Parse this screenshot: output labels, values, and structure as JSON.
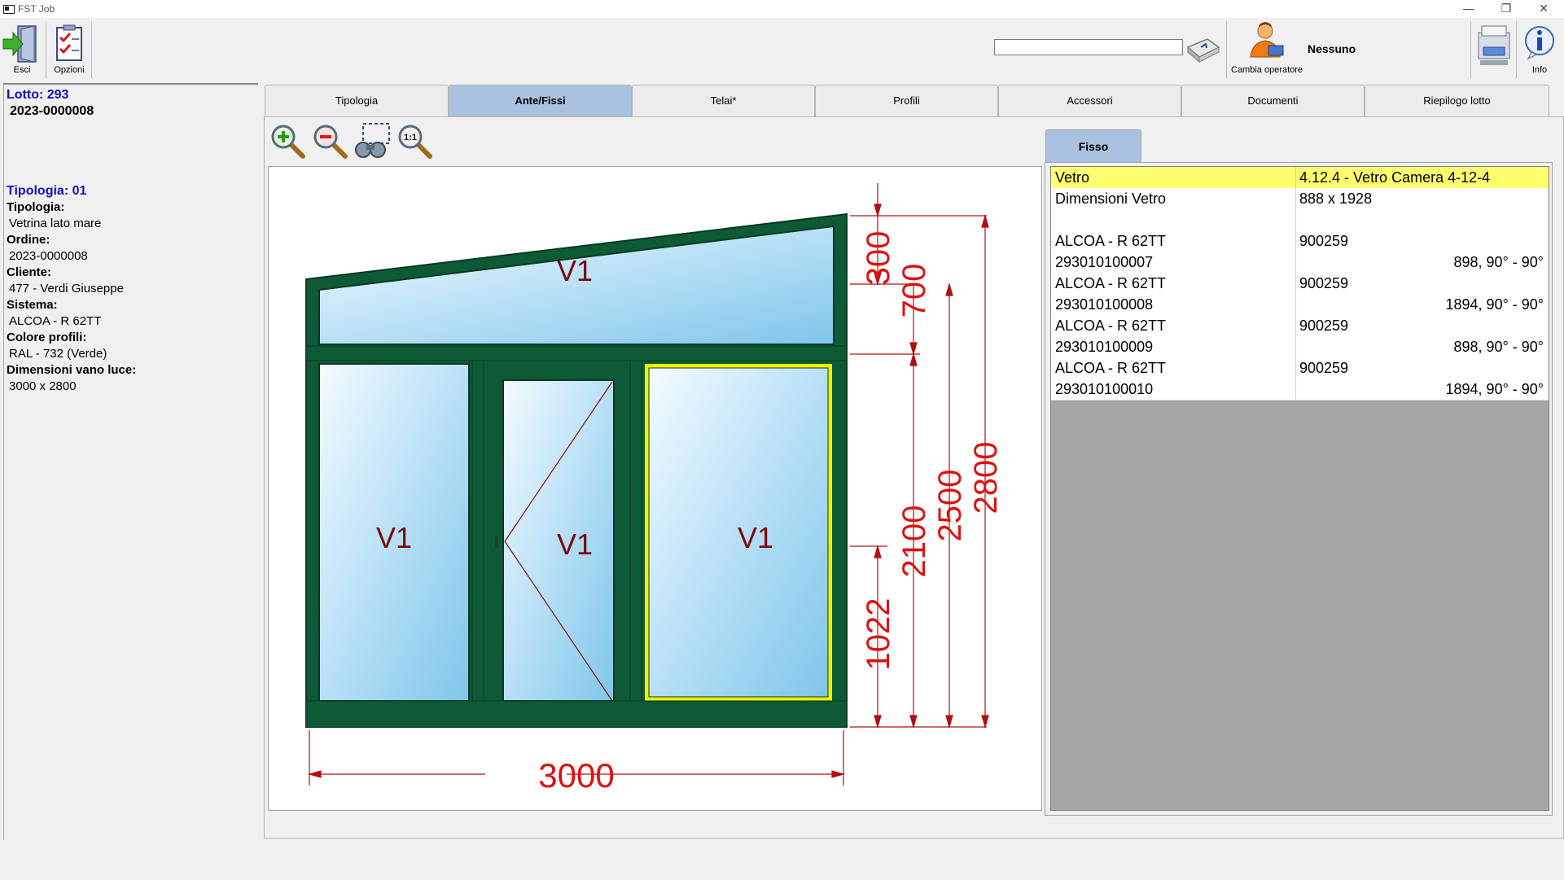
{
  "window": {
    "title": "FST Job",
    "minimize_glyph": "—",
    "restore_glyph": "❐",
    "close_glyph": "✕"
  },
  "toolbar": {
    "exit_label": "Esci",
    "options_label": "Opzioni",
    "change_operator_label": "Cambia operatore",
    "operator_name": "Nessuno",
    "info_label": "Info"
  },
  "left_panel": {
    "lotto_label": "Lotto: 293",
    "lotto_code": "2023-0000008",
    "tipologia_header": "Tipologia: 01",
    "tipologia_label": "Tipologia:",
    "tipologia_value": "Vetrina lato mare",
    "ordine_label": "Ordine:",
    "ordine_value": "2023-0000008",
    "cliente_label": "Cliente:",
    "cliente_value": "477 - Verdi Giuseppe",
    "sistema_label": "Sistema:",
    "sistema_value": "ALCOA - R 62TT",
    "colore_label": "Colore profili:",
    "colore_value": "RAL - 732 (Verde)",
    "dimensioni_label": "Dimensioni vano luce:",
    "dimensioni_value": "3000 x 2800"
  },
  "tabs": [
    "Tipologia",
    "Ante/Fissi",
    "Telai*",
    "Profili",
    "Accessori",
    "Documenti",
    "Riepilogo lotto"
  ],
  "active_tab": "Ante/Fissi",
  "zoom_actual_label": "1:1",
  "drawing": {
    "panel_labels": [
      "V1",
      "V1",
      "V1",
      "V1"
    ],
    "dim_width": "3000",
    "dim_300": "300",
    "dim_700": "700",
    "dim_1022": "1022",
    "dim_2100": "2100",
    "dim_2500": "2500",
    "dim_2800": "2800",
    "frame_color": "#0e5a36",
    "glass_color": "#a8d8f0",
    "dimension_color": "#e01010",
    "highlight_color": "#f0f000"
  },
  "right_panel": {
    "tab_label": "Fisso",
    "rows": [
      {
        "c1": "Vetro",
        "c2": "4.12.4 - Vetro Camera 4-12-4",
        "c3": ""
      },
      {
        "c1": "Dimensioni Vetro",
        "c2": "888 x 1928",
        "c3": ""
      },
      {
        "c1": "",
        "c2": "",
        "c3": ""
      },
      {
        "c1": "ALCOA - R 62TT",
        "c2": "900259",
        "c3": ""
      },
      {
        "c1": "293010100007",
        "c2": "",
        "c3": "898, 90° - 90°"
      },
      {
        "c1": "ALCOA - R 62TT",
        "c2": "900259",
        "c3": ""
      },
      {
        "c1": "293010100008",
        "c2": "",
        "c3": "1894, 90° - 90°"
      },
      {
        "c1": "ALCOA - R 62TT",
        "c2": "900259",
        "c3": ""
      },
      {
        "c1": "293010100009",
        "c2": "",
        "c3": "898, 90° - 90°"
      },
      {
        "c1": "ALCOA - R 62TT",
        "c2": "900259",
        "c3": ""
      },
      {
        "c1": "293010100010",
        "c2": "",
        "c3": "1894, 90° - 90°"
      }
    ]
  }
}
